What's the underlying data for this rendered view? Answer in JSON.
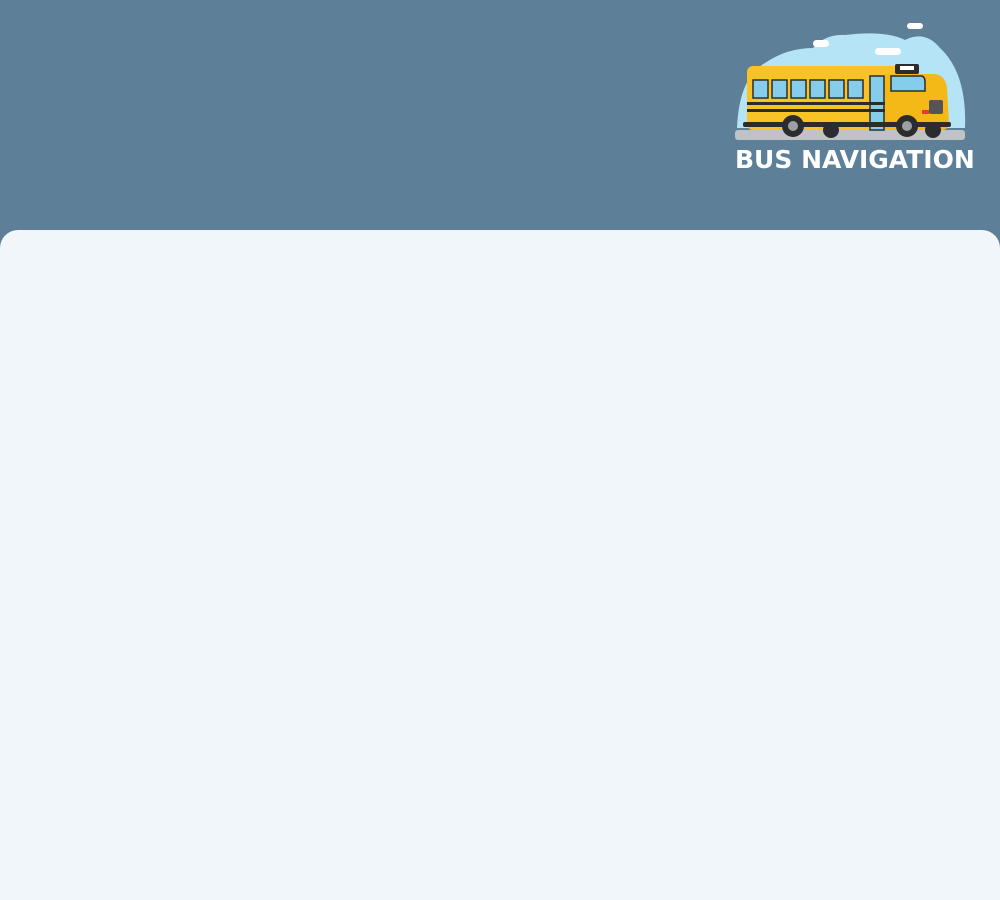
{
  "header": {
    "logo": {
      "icon": "school-bus-icon",
      "text": "BUS NAVIGATION"
    }
  },
  "colors": {
    "header_background": "#5e7f98",
    "content_background": "#f1f6fa",
    "bus_yellow": "#f7c325",
    "sky": "#b6e4f7",
    "logo_text": "#ffffff"
  }
}
